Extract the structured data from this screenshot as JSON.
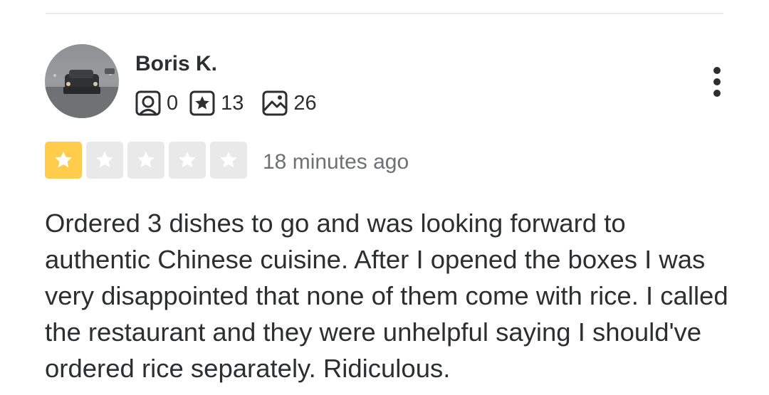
{
  "review": {
    "user": {
      "name": "Boris K.",
      "avatar_icon": "car-in-rain-photo"
    },
    "stats": {
      "friends": "0",
      "reviews": "13",
      "photos": "26"
    },
    "rating": {
      "value": 1,
      "max": 5,
      "filled_color": "#ffcc4b",
      "empty_color": "#e9e9e9"
    },
    "timestamp": "18 minutes ago",
    "text": "Ordered 3 dishes to go and was looking forward to authentic Chinese cuisine. After I opened the boxes I was very disappointed that none of them come with rice. I called the restaurant and they were unhelpful saying I should've ordered rice separately. Ridiculous."
  },
  "icons": {
    "friends": "friends-icon",
    "reviews": "review-star-icon",
    "photos": "photo-icon",
    "more": "more-vertical-icon"
  }
}
